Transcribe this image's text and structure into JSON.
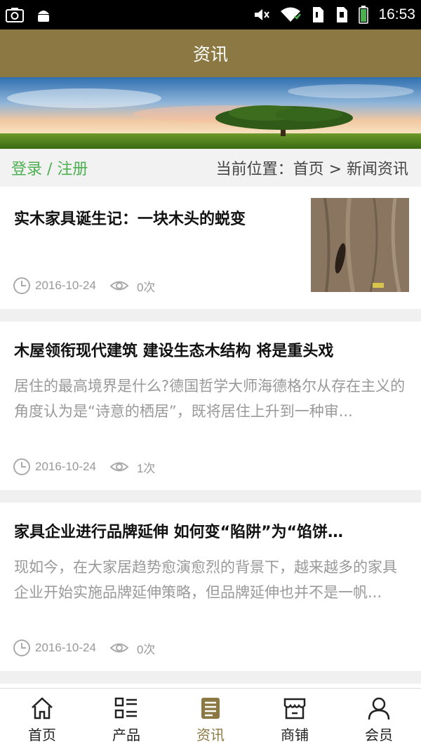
{
  "status_bar": {
    "time": "16:53",
    "icons": [
      "camera-icon",
      "android-icon",
      "mute-icon",
      "wifi-icon",
      "sim1-icon",
      "sim2-icon",
      "battery-icon"
    ]
  },
  "header": {
    "title": "资讯"
  },
  "location_bar": {
    "login": "登录 / 注册",
    "breadcrumb": "当前位置：首页 > 新闻资讯"
  },
  "articles": [
    {
      "title": "实木家具诞生记：一块木头的蜕变",
      "date": "2016-10-24",
      "views": "0次"
    },
    {
      "title": "木屋领衔现代建筑 建设生态木结构 将是重头戏",
      "summary": "居住的最高境界是什么?德国哲学大师海德格尔从存在主义的角度认为是“诗意的栖居”，既将居住上升到一种审...",
      "date": "2016-10-24",
      "views": "1次"
    },
    {
      "title": "家具企业进行品牌延伸 如何变“陷阱”为“馅饼…",
      "summary": "现如今，在大家居趋势愈演愈烈的背景下，越来越多的家具企业开始实施品牌延伸策略，但品牌延伸也并不是一帆...",
      "date": "2016-10-24",
      "views": "0次"
    }
  ],
  "tabbar": {
    "items": [
      {
        "label": "首页",
        "icon": "home-icon"
      },
      {
        "label": "产品",
        "icon": "list-icon"
      },
      {
        "label": "资讯",
        "icon": "document-icon",
        "active": true
      },
      {
        "label": "商铺",
        "icon": "store-icon"
      },
      {
        "label": "会员",
        "icon": "user-icon"
      }
    ]
  },
  "colors": {
    "brand": "#8b7842",
    "login": "#4caf50",
    "muted_text": "#999999"
  }
}
